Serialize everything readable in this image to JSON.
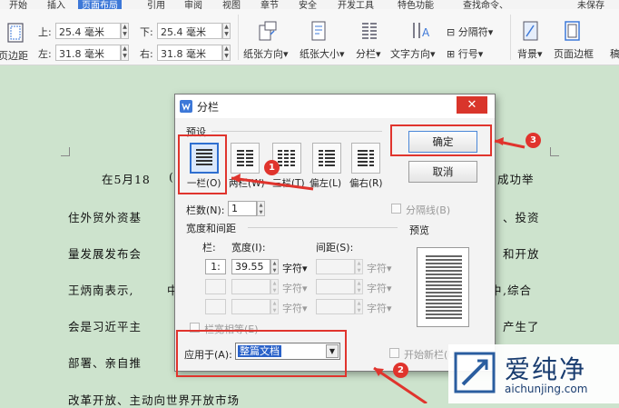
{
  "menubar": {
    "items": [
      "开始",
      "插入",
      "页面布局",
      "引用",
      "审阅",
      "视图",
      "章节",
      "安全",
      "开发工具",
      "特色功能",
      "查找命令、",
      "未保存"
    ],
    "active_index": 2
  },
  "ribbon": {
    "margins_button": "页边距",
    "top_label": "上:",
    "top_value": "25.4 毫米",
    "bottom_label": "下:",
    "bottom_value": "25.4 毫米",
    "left_label": "左:",
    "left_value": "31.8 毫米",
    "right_label": "右:",
    "right_value": "31.8 毫米",
    "orientation": "纸张方向",
    "paper_size": "纸张大小",
    "columns": "分栏",
    "text_direction": "文字方向",
    "breaks": "分隔符",
    "line_numbers": "行号",
    "background": "背景",
    "page_border": "页面边框",
    "extra": "稿"
  },
  "document": {
    "lines": [
      {
        "left": "在5月18",
        "right": "成功举"
      },
      {
        "left": "住外贸外资基",
        "right": "、投资"
      },
      {
        "left": "量发展发布会",
        "right": "和开放"
      },
      {
        "left": "王炳南表示,",
        "right": ",综合"
      },
      {
        "left": "会是习近平主",
        "right": "产生了"
      },
      {
        "left": "部署、亲自推",
        "right": ""
      },
      {
        "left": "改革开放、主动向世界开放市场",
        "right": ""
      }
    ],
    "hidden_char": "(",
    "hidden_char2": "中",
    "hidden_char3": "中"
  },
  "dialog": {
    "title": "分栏",
    "close": "✕",
    "presets_label": "预设",
    "presets": [
      "一栏(O)",
      "两栏(W)",
      "三栏(T)",
      "偏左(L)",
      "偏右(R)"
    ],
    "ok": "确定",
    "cancel": "取消",
    "num_cols_label": "栏数(N):",
    "num_cols_value": "1",
    "separator": "分隔线(B)",
    "width_spacing": "宽度和间距",
    "col_header": "栏:",
    "width_header": "宽度(I):",
    "spacing_header": "间距(S):",
    "row1_col": "1:",
    "row1_width": "39.55",
    "unit": "字符",
    "equal_width": "栏宽相等(E)",
    "preview": "预览",
    "apply_label": "应用于(A):",
    "apply_value": "整篇文档",
    "new_col": "开始新栏(U)"
  },
  "annotations": {
    "n1": "1",
    "n2": "2",
    "n3": "3"
  },
  "watermark": {
    "cn": "爱纯净",
    "url": "aichunjing.com"
  },
  "colors": {
    "accent": "#e0342d",
    "selection": "#3d78d8",
    "doc_bg": "#cde3cd"
  }
}
